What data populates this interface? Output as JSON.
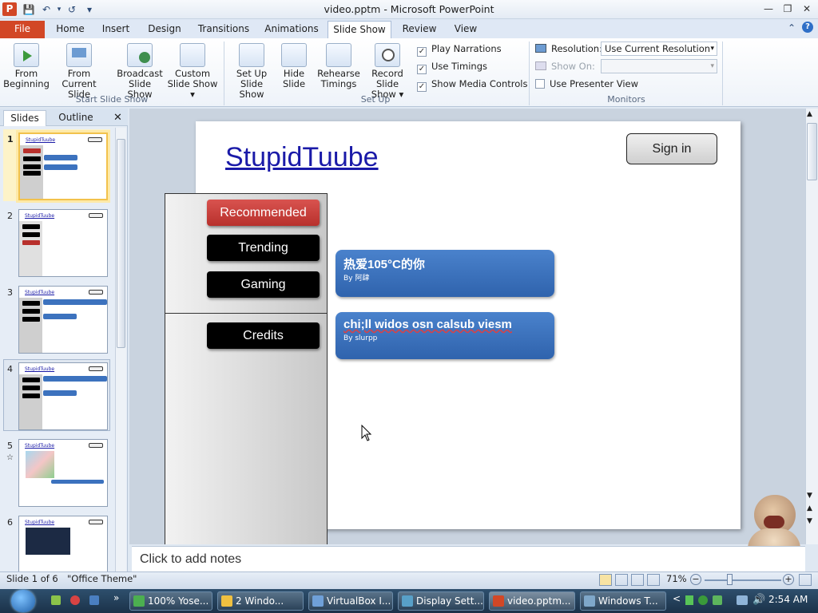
{
  "window": {
    "title": "video.pptm - Microsoft PowerPoint",
    "app_icon": "P"
  },
  "ribbon": {
    "tabs": [
      "File",
      "Home",
      "Insert",
      "Design",
      "Transitions",
      "Animations",
      "Slide Show",
      "Review",
      "View"
    ],
    "active_tab": "Slide Show",
    "groups": {
      "start": {
        "label": "Start Slide Show",
        "buttons": [
          {
            "l1": "From",
            "l2": "Beginning"
          },
          {
            "l1": "From",
            "l2": "Current Slide"
          },
          {
            "l1": "Broadcast",
            "l2": "Slide Show"
          },
          {
            "l1": "Custom",
            "l2": "Slide Show ▾"
          }
        ]
      },
      "setup": {
        "label": "Set Up",
        "buttons": [
          {
            "l1": "Set Up",
            "l2": "Slide Show"
          },
          {
            "l1": "Hide",
            "l2": "Slide"
          },
          {
            "l1": "Rehearse",
            "l2": "Timings"
          },
          {
            "l1": "Record Slide",
            "l2": "Show ▾"
          }
        ],
        "checks": [
          {
            "label": "Play Narrations",
            "checked": true
          },
          {
            "label": "Use Timings",
            "checked": true
          },
          {
            "label": "Show Media Controls",
            "checked": true
          }
        ]
      },
      "monitors": {
        "label": "Monitors",
        "resolution_label": "Resolution:",
        "resolution_value": "Use Current Resolution",
        "show_on_label": "Show On:",
        "presenter_view": "Use Presenter View",
        "presenter_checked": false
      }
    }
  },
  "slides_pane": {
    "tabs": [
      "Slides",
      "Outline"
    ],
    "active_tab": "Slides",
    "thumb_title": "StupidTuube",
    "numbers": [
      "1",
      "2",
      "3",
      "4",
      "5",
      "6"
    ],
    "selected": 1
  },
  "slide": {
    "site_title": "StupidTuube",
    "sign_in": "Sign in",
    "nav": [
      "Recommended",
      "Trending",
      "Gaming"
    ],
    "credits": "Credits",
    "videos": [
      {
        "title": "热爱105°C的你",
        "by": "By 阿肆"
      },
      {
        "title": "chi;ll widos osn calsub viesm",
        "by": "By slurpp"
      }
    ]
  },
  "notes": {
    "placeholder": "Click to add notes"
  },
  "statusbar": {
    "slide_info": "Slide 1 of 6",
    "theme": "\"Office Theme\"",
    "zoom": "71%"
  },
  "taskbar": {
    "items": [
      {
        "label": "100% Yose...",
        "color": "#4caf50"
      },
      {
        "label": "2 Windo...",
        "color": "#f0c040"
      },
      {
        "label": "VirtualBox I...",
        "color": "#6fa0d8"
      },
      {
        "label": "Display Sett...",
        "color": "#58a0c8"
      },
      {
        "label": "video.pptm...",
        "color": "#d24726"
      },
      {
        "label": "Windows T...",
        "color": "#7fa7c9"
      }
    ],
    "active_index": 4,
    "clock": "2:54 AM"
  }
}
